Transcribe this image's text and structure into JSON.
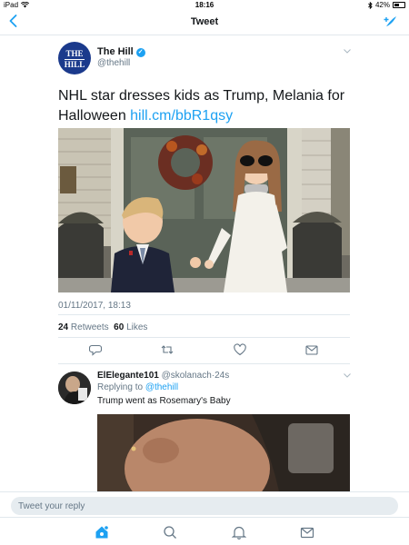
{
  "status_bar": {
    "device": "iPad",
    "time": "18:16",
    "battery": "42%",
    "battery_level": 0.42
  },
  "nav": {
    "title": "Tweet",
    "back_icon": "chevron-left-icon",
    "compose_icon": "compose-tweet-icon"
  },
  "tweet": {
    "avatar_text_line1": "THE",
    "avatar_text_line2": "HILL",
    "author_name": "The Hill",
    "author_handle": "@thehill",
    "text": "NHL star dresses kids as Trump, Melania for Halloween ",
    "link": "hill.cm/bbR1qsy",
    "timestamp": "01/11/2017, 18:13",
    "retweets_count": "24",
    "retweets_label": "Retweets",
    "likes_count": "60",
    "likes_label": "Likes"
  },
  "reply": {
    "author_name": "ElElegante101",
    "author_handle": "@skolanach",
    "separator": "·",
    "age": "24s",
    "replying_prefix": "Replying to ",
    "replying_to": "@thehill",
    "text": "Trump went as Rosemary's Baby"
  },
  "reply_bar": {
    "placeholder": "Tweet your reply"
  },
  "colors": {
    "accent": "#1da1f2",
    "secondary_text": "#657786",
    "divider": "#e1e8ed"
  }
}
